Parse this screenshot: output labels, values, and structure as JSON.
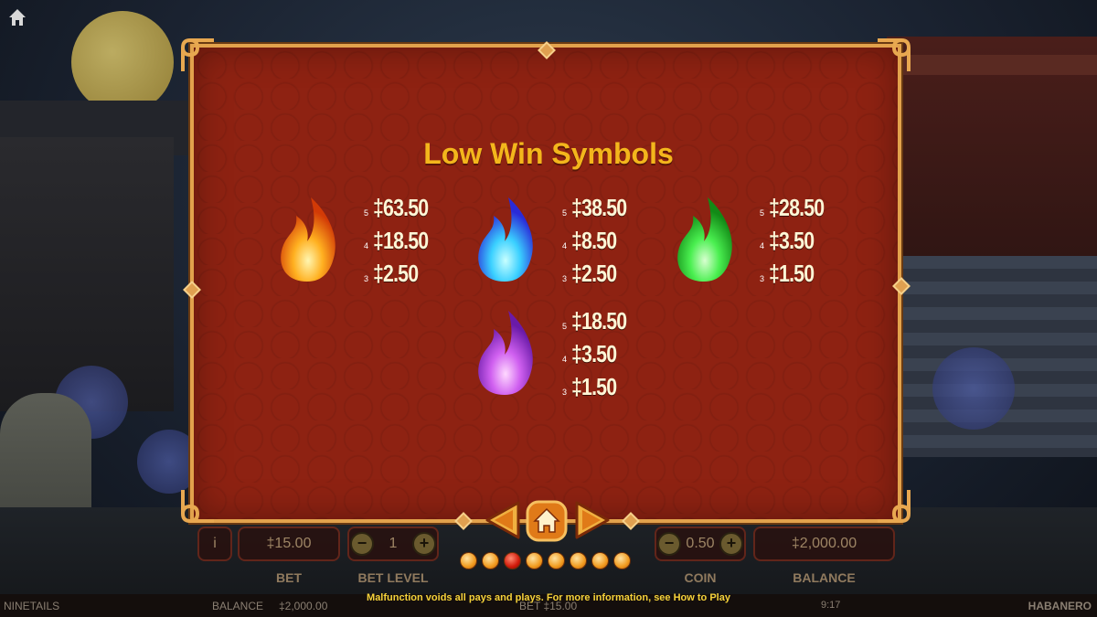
{
  "panel": {
    "title": "Low Win Symbols"
  },
  "symbols": [
    {
      "name": "orange-flame",
      "color": "#f29020",
      "pays": [
        {
          "count": "5",
          "amount": "‡63.50"
        },
        {
          "count": "4",
          "amount": "‡18.50"
        },
        {
          "count": "3",
          "amount": "‡2.50"
        }
      ]
    },
    {
      "name": "blue-flame",
      "color": "#3a5cff",
      "pays": [
        {
          "count": "5",
          "amount": "‡38.50"
        },
        {
          "count": "4",
          "amount": "‡8.50"
        },
        {
          "count": "3",
          "amount": "‡2.50"
        }
      ]
    },
    {
      "name": "green-flame",
      "color": "#2fd02a",
      "pays": [
        {
          "count": "5",
          "amount": "‡28.50"
        },
        {
          "count": "4",
          "amount": "‡3.50"
        },
        {
          "count": "3",
          "amount": "‡1.50"
        }
      ]
    },
    {
      "name": "purple-flame",
      "color": "#b63ae0",
      "pays": [
        {
          "count": "5",
          "amount": "‡18.50"
        },
        {
          "count": "4",
          "amount": "‡3.50"
        },
        {
          "count": "3",
          "amount": "‡1.50"
        }
      ]
    }
  ],
  "navigation": {
    "prev": "left-arrow-icon",
    "home": "home-icon",
    "next": "right-arrow-icon",
    "page_count": 8,
    "active_page": 3
  },
  "controls": {
    "bet_value": "‡15.00",
    "bet_label": "BET",
    "bet_level_value": "1",
    "bet_level_label": "BET LEVEL",
    "coin_value": "0.50",
    "coin_label": "COIN",
    "balance_value": "‡2,000.00",
    "balance_label": "BALANCE"
  },
  "footer": {
    "game_name": "NINETAILS",
    "balance_label": "BALANCE",
    "balance_value": "‡2,000.00",
    "bet_text": "BET ‡15.00",
    "disclaimer": "Malfunction voids all pays and plays.  For more information, see How to Play",
    "time": "9:17",
    "brand": "HABANERO"
  },
  "colors": {
    "panel_bg": "#8e2212",
    "panel_border": "#e2a24c",
    "title": "#f3b61c",
    "disclaimer": "#f5d23a"
  }
}
